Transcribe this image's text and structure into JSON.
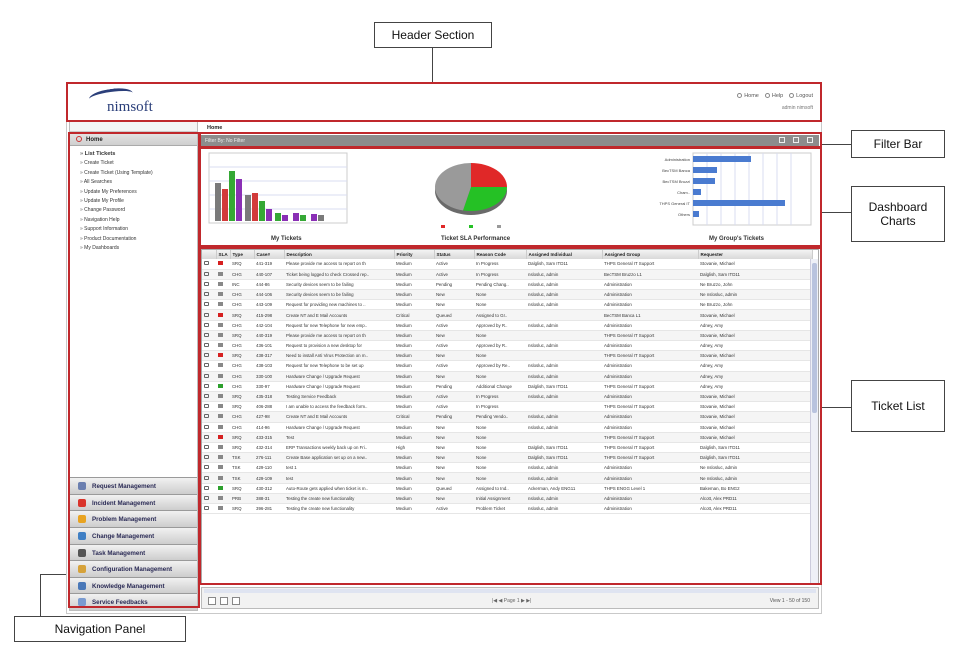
{
  "callouts": {
    "header": "Header Section",
    "filter": "Filter Bar",
    "dashboard": "Dashboard Charts",
    "tickets": "Ticket List",
    "nav": "Navigation Panel"
  },
  "header": {
    "logo": "nimsoft",
    "links": [
      "Home",
      "Help",
      "Logout"
    ],
    "user": "admin nimsoft"
  },
  "nav": {
    "home": "Home",
    "items": [
      "List Tickets",
      "Create Ticket",
      "Create Ticket (Using Template)",
      "All Searches",
      "Update My Preferences",
      "Update My Profile",
      "Change Password",
      "Navigation Help",
      "Support Information",
      "Product Documentation",
      "My Dashboards"
    ],
    "modules": [
      {
        "label": "Request Management",
        "color": "#6b7fb0"
      },
      {
        "label": "Incident Management",
        "color": "#d9342b"
      },
      {
        "label": "Problem Management",
        "color": "#e8a321"
      },
      {
        "label": "Change Management",
        "color": "#3f7fc4"
      },
      {
        "label": "Task Management",
        "color": "#555555"
      },
      {
        "label": "Configuration Management",
        "color": "#d6a23a"
      },
      {
        "label": "Knowledge Management",
        "color": "#4a78b8"
      },
      {
        "label": "Service Feedbacks",
        "color": "#7a9bd0"
      }
    ]
  },
  "breadcrumb": "Home",
  "filterbar": "Filter By: No Filter",
  "charts": {
    "my_tickets": "My Tickets",
    "sla": "Ticket SLA Performance",
    "group": "My Group's Tickets",
    "group_labels": [
      "Administration",
      "BecTSM Banca",
      "BecTSM Bruzzi",
      "Cham..",
      "THPS General IT",
      "Others"
    ]
  },
  "tickets": {
    "columns": [
      "",
      "SLA",
      "Type",
      "Case#",
      "Description",
      "Priority",
      "Status",
      "Reason Code",
      "Assigned Individual",
      "Assigned Group",
      "Requester"
    ],
    "rows": [
      [
        "SRQ",
        "441-319",
        "Please provide me access to report on th",
        "Medium",
        "Active",
        "In Progress",
        "Dalglish, Sam ITD11",
        "THPS General IT Support",
        "Stovanie, Michael",
        "red"
      ],
      [
        "CHG",
        "440-107",
        "Ticket being logged to check Crossed rep..",
        "Medium",
        "Active",
        "In Progress",
        "nslosluc, admin",
        "BecTSM Bruzzo L1",
        "Dalglish, Sam ITD11",
        "grey"
      ],
      [
        "INC",
        "444-86",
        "Security devices seem to be failing",
        "Medium",
        "Pending",
        "Pending Chang..",
        "nslosluc, admin",
        "Administration",
        "Ne Bruzzo, John",
        "grey"
      ],
      [
        "CHG",
        "444-106",
        "Security devices seem to be failing",
        "Medium",
        "New",
        "None",
        "nslosluc, admin",
        "Administration",
        "Ne nslosluc, admin",
        "grey"
      ],
      [
        "CHG",
        "443-109",
        "Request for providing new machines to ..",
        "Medium",
        "New",
        "None",
        "nslosluc, admin",
        "Administration",
        "Ne Bruzzo, John",
        "grey"
      ],
      [
        "SRQ",
        "415-298",
        "Create NT and E Mail Accounts",
        "Critical",
        "Queued",
        "Assigned to Gr..",
        "",
        "BecTSM Banca L1",
        "Stovanie, Michael",
        "red"
      ],
      [
        "CHG",
        "442-104",
        "Request for new Telephone for new emp..",
        "Medium",
        "Active",
        "Approved by R..",
        "nslosluc, admin",
        "Administration",
        "Adney, Amy",
        "grey"
      ],
      [
        "SRQ",
        "440-319",
        "Please provide me access to report on th",
        "Medium",
        "New",
        "None",
        "",
        "THPS General IT Support",
        "Stovanie, Michael",
        "grey"
      ],
      [
        "CHG",
        "436-101",
        "Request to provision a new desktop for",
        "Medium",
        "Active",
        "Approved by R..",
        "nslosluc, admin",
        "Administration",
        "Adney, Amy",
        "grey"
      ],
      [
        "SRQ",
        "438-317",
        "Need to install Anti Virus Protection on m..",
        "Medium",
        "New",
        "None",
        "",
        "THPS General IT Support",
        "Stovanie, Michael",
        "red"
      ],
      [
        "CHG",
        "438-103",
        "Request for new Telephone to be set up",
        "Medium",
        "Active",
        "Approved by Re..",
        "nslosluc, admin",
        "Administration",
        "Adney, Amy",
        "grey"
      ],
      [
        "CHG",
        "330-100",
        "Hardware Change / Upgrade Request",
        "Medium",
        "New",
        "None",
        "nslosluc, admin",
        "Administration",
        "Adney, Amy",
        "grey"
      ],
      [
        "CHG",
        "330-97",
        "Hardware Change / Upgrade Request",
        "Medium",
        "Pending",
        "Additional Change",
        "Dalglish, Sam ITD11",
        "THPS General IT Support",
        "Adney, Amy",
        "green"
      ],
      [
        "SRQ",
        "435-318",
        "Testing Service Feedback",
        "Medium",
        "Active",
        "In Progress",
        "nslosluc, admin",
        "Administration",
        "Stovanie, Michael",
        "grey"
      ],
      [
        "SRQ",
        "406-288",
        "I am unable to access the feedback form..",
        "Medium",
        "Active",
        "In Progress",
        "",
        "THPS General IT Support",
        "Stovanie, Michael",
        "grey"
      ],
      [
        "CHG",
        "427-98",
        "Create NT and E Mail Accounts",
        "Critical",
        "Pending",
        "Pending Vendo..",
        "nslosluc, admin",
        "Administration",
        "Stovanie, Michael",
        "grey"
      ],
      [
        "CHG",
        "414-96",
        "Hardware Change / Upgrade Request",
        "Medium",
        "New",
        "None",
        "nslosluc, admin",
        "Administration",
        "Stovanie, Michael",
        "grey"
      ],
      [
        "SRQ",
        "433-315",
        "Test",
        "Medium",
        "New",
        "None",
        "",
        "THPS General IT Support",
        "Stovanie, Michael",
        "red"
      ],
      [
        "SRQ",
        "432-314",
        "ERP Transactions weekly back up on Fri..",
        "High",
        "New",
        "None",
        "Dalglish, Sam ITD11",
        "THPS General IT Support",
        "Dalglish, Sam ITD11",
        "grey"
      ],
      [
        "TSK",
        "276-111",
        "Create Base application set up on a new..",
        "Medium",
        "New",
        "None",
        "Dalglish, Sam ITD11",
        "THPS General IT Support",
        "Dalglish, Sam ITD11",
        "grey"
      ],
      [
        "TSK",
        "429-110",
        "test 1",
        "Medium",
        "New",
        "None",
        "nslosluc, admin",
        "Administration",
        "Ne nslosluc, admin",
        "grey"
      ],
      [
        "TSK",
        "429-109",
        "test",
        "Medium",
        "New",
        "None",
        "nslosluc, admin",
        "Administration",
        "Ne nslosluc, admin",
        "grey"
      ],
      [
        "SRQ",
        "430-312",
        "Auto-Route gets applied when ticket is m..",
        "Medium",
        "Queued",
        "Assigned to Ind..",
        "Ackerman, Andy ENG11",
        "THPS ENGG Level 1",
        "Bakeman, Bo ENG2",
        "green"
      ],
      [
        "PRB",
        "388-31",
        "Testing the create new functionality",
        "Medium",
        "New",
        "Initial Assignment",
        "nslosluc, admin",
        "Administration",
        "Alcott, Alex PRD11",
        "grey"
      ],
      [
        "SRQ",
        "396-281",
        "Testing the create new functionality",
        "Medium",
        "Active",
        "Problem Ticket",
        "nslosluc, admin",
        "Administration",
        "Alcott, Alex PRD11",
        "grey"
      ]
    ]
  },
  "pager": {
    "nav": "|◀ ◀ Page 1 ▶ ▶|",
    "view": "View 1 - 50 of 150"
  }
}
